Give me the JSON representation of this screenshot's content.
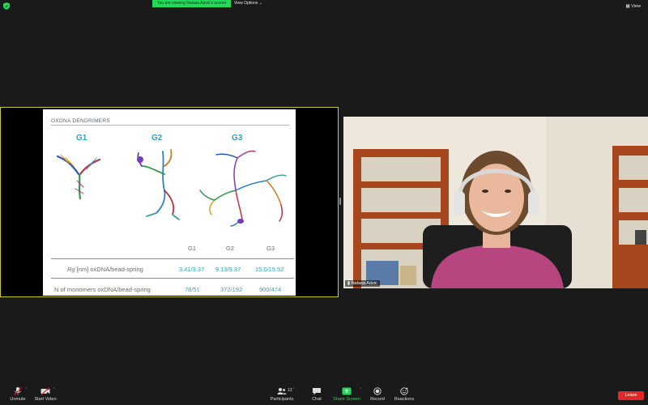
{
  "top_bar": {
    "viewing_text": "You are viewing Natasa Adzic's screen",
    "view_options_label": "View Options",
    "view_label": "View",
    "colors": {
      "viewing_badge": "#23d959",
      "security_shield": "#23d959"
    }
  },
  "shared_slide": {
    "title": "OXDNA DENDRIMERS",
    "generations": [
      "G1",
      "G2",
      "G3"
    ],
    "table": {
      "columns": [
        "G1",
        "G2",
        "G3"
      ],
      "rows": [
        {
          "label_prefix": "Rg",
          "label_suffix": " [nm] oxDNA/bead-spring",
          "values": [
            "3.41/3.37",
            "9.13/9.37",
            "15.0/15.52"
          ]
        },
        {
          "label_prefix": "",
          "label_suffix": "N of monomers oxDNA/bead-spring",
          "values": [
            "78/51",
            "372/192",
            "900/474"
          ]
        }
      ]
    },
    "colors": {
      "accent": "#2aa5c7",
      "frame_border": "#c8c82a"
    }
  },
  "video": {
    "participant_name": "Natasa Adzic",
    "signal_icon": "signal-bars-icon"
  },
  "toolbar": {
    "unmute_label": "Unmute",
    "start_video_label": "Start Video",
    "participants_label": "Participants",
    "participants_count": "13",
    "chat_label": "Chat",
    "share_screen_label": "Share Screen",
    "record_label": "Record",
    "reactions_label": "Reactions",
    "leave_label": "Leave",
    "colors": {
      "share_screen": "#23d959",
      "leave": "#e02828"
    }
  }
}
